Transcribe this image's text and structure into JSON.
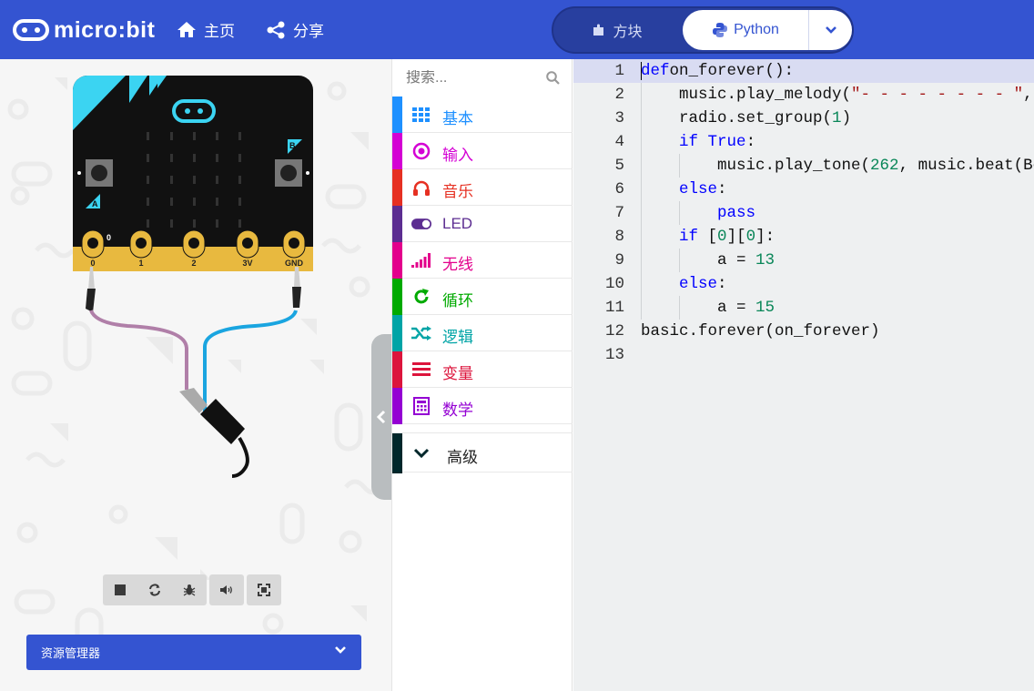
{
  "header": {
    "brand": "micro:bit",
    "nav": [
      {
        "label": "主页",
        "icon": "home-icon"
      },
      {
        "label": "分享",
        "icon": "share-icon"
      }
    ],
    "editor_toggle": {
      "blocks_label": "方块",
      "python_label": "Python",
      "active": "Python"
    }
  },
  "simulator": {
    "pins": [
      "0",
      "1",
      "2",
      "3V",
      "GND"
    ],
    "pin0_marker": "0",
    "buttons": [
      "A",
      "B"
    ],
    "controls": [
      "stop-icon",
      "restart-icon",
      "debug-icon",
      "mute-icon",
      "fullscreen-icon"
    ],
    "explorer_label": "资源管理器"
  },
  "toolbox": {
    "search_placeholder": "搜索...",
    "categories": [
      {
        "label": "基本",
        "color": "#1E90FF",
        "icon": "grid-icon"
      },
      {
        "label": "输入",
        "color": "#D400D4",
        "icon": "target-icon"
      },
      {
        "label": "音乐",
        "color": "#E63022",
        "icon": "headphones-icon"
      },
      {
        "label": "LED",
        "color": "#5C2D91",
        "icon": "toggle-icon"
      },
      {
        "label": "无线",
        "color": "#E3008C",
        "icon": "signal-icon"
      },
      {
        "label": "循环",
        "color": "#00AA00",
        "icon": "refresh-icon"
      },
      {
        "label": "逻辑",
        "color": "#00A4A6",
        "icon": "shuffle-icon"
      },
      {
        "label": "变量",
        "color": "#DC143C",
        "icon": "list-icon"
      },
      {
        "label": "数学",
        "color": "#9400D3",
        "icon": "calculator-icon"
      }
    ],
    "advanced": {
      "label": "高级",
      "color": "#00272B"
    }
  },
  "editor": {
    "current_line": 1,
    "lines": [
      {
        "n": "1",
        "indent": 0,
        "tokens": [
          [
            "kw",
            "def"
          ],
          [
            "",
            "on_forever():"
          ]
        ]
      },
      {
        "n": "2",
        "indent": 1,
        "tokens": [
          [
            "",
            "music.play_melody("
          ],
          [
            "str",
            "\"- - - - - - - - \""
          ],
          [
            "",
            ", "
          ]
        ]
      },
      {
        "n": "3",
        "indent": 1,
        "tokens": [
          [
            "",
            "radio.set_group("
          ],
          [
            "num",
            "1"
          ],
          [
            "",
            ")"
          ]
        ]
      },
      {
        "n": "4",
        "indent": 1,
        "tokens": [
          [
            "kw",
            "if"
          ],
          [
            "",
            " "
          ],
          [
            "kw",
            "True"
          ],
          [
            "",
            ":"
          ]
        ]
      },
      {
        "n": "5",
        "indent": 2,
        "tokens": [
          [
            "",
            "music.play_tone("
          ],
          [
            "num",
            "262"
          ],
          [
            "",
            ", music.beat(Be"
          ]
        ]
      },
      {
        "n": "6",
        "indent": 1,
        "tokens": [
          [
            "kw",
            "else"
          ],
          [
            "",
            ":"
          ]
        ]
      },
      {
        "n": "7",
        "indent": 2,
        "tokens": [
          [
            "kw",
            "pass"
          ]
        ]
      },
      {
        "n": "8",
        "indent": 1,
        "tokens": [
          [
            "kw",
            "if"
          ],
          [
            "",
            " ["
          ],
          [
            "num",
            "0"
          ],
          [
            "",
            "]["
          ],
          [
            "num",
            "0"
          ],
          [
            "",
            "]:"
          ]
        ]
      },
      {
        "n": "9",
        "indent": 2,
        "tokens": [
          [
            "",
            "a = "
          ],
          [
            "num",
            "13"
          ]
        ]
      },
      {
        "n": "10",
        "indent": 1,
        "tokens": [
          [
            "kw",
            "else"
          ],
          [
            "",
            ":"
          ]
        ]
      },
      {
        "n": "11",
        "indent": 2,
        "tokens": [
          [
            "",
            "a = "
          ],
          [
            "num",
            "15"
          ]
        ]
      },
      {
        "n": "12",
        "indent": 0,
        "tokens": [
          [
            "",
            "basic.forever(on_forever)"
          ]
        ]
      },
      {
        "n": "13",
        "indent": 0,
        "tokens": []
      }
    ]
  }
}
